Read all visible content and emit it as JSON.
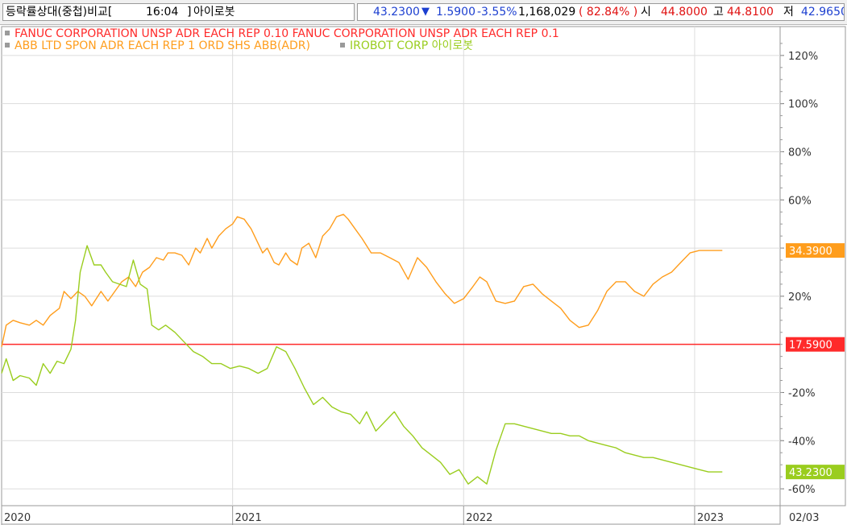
{
  "header": {
    "title": "등락률상대(중첩)비교[",
    "time": "16:04",
    "bracket": "]",
    "stock_name": "아이로봇",
    "price": "43.2300",
    "arrow": "▼",
    "change": "1.5900",
    "change_pct": "-3.55%",
    "volume": "1,168,029",
    "ratio": "( 82.84% )",
    "open_label": "시",
    "open": "44.8000",
    "high_label": "고",
    "high": "44.8100",
    "low_label": "저",
    "low": "42.9650"
  },
  "colors": {
    "fanuc": "#ff2a2a",
    "abb": "#ff9d1c",
    "irobot": "#9acd1e",
    "text_blue": "#1c3fd0",
    "text_red": "#e01010",
    "grid": "#dcdcdc"
  },
  "chart_data": {
    "type": "line",
    "x_ticks": [
      "2020",
      "2021",
      "2022",
      "2023",
      "02/03"
    ],
    "y_ticks": [
      "120%",
      "100%",
      "80%",
      "60%",
      "40%",
      "20%",
      "-20%",
      "-40%",
      "-60%"
    ],
    "legend": [
      "FANUC CORPORATION UNSP ADR EACH REP 0.10  FANUC CORPORATION UNSP ADR EACH REP 0.1",
      "ABB LTD SPON ADR EACH REP 1 ORD SHS  ABB(ADR)",
      "IROBOT CORP  아이로봇"
    ],
    "end_labels": {
      "fanuc": "17.5900",
      "abb": "34.3900",
      "irobot": "43.2300"
    },
    "series": [
      {
        "name": "FANUC CORPORATION UNSP ADR EACH REP 0.10",
        "key": "fanuc",
        "x": [
          0,
          3.12
        ],
        "y": [
          0,
          0
        ]
      },
      {
        "name": "ABB LTD SPON ADR EACH REP 1 ORD SHS",
        "key": "abb",
        "x": [
          0,
          0.02,
          0.05,
          0.08,
          0.12,
          0.15,
          0.18,
          0.21,
          0.25,
          0.27,
          0.3,
          0.33,
          0.36,
          0.39,
          0.43,
          0.46,
          0.49,
          0.52,
          0.55,
          0.58,
          0.61,
          0.64,
          0.67,
          0.7,
          0.72,
          0.75,
          0.78,
          0.81,
          0.84,
          0.86,
          0.89,
          0.91,
          0.94,
          0.97,
          1.0,
          1.02,
          1.05,
          1.08,
          1.1,
          1.13,
          1.15,
          1.18,
          1.2,
          1.23,
          1.25,
          1.28,
          1.3,
          1.33,
          1.36,
          1.39,
          1.42,
          1.45,
          1.48,
          1.5,
          1.53,
          1.56,
          1.6,
          1.64,
          1.68,
          1.72,
          1.76,
          1.8,
          1.84,
          1.88,
          1.92,
          1.96,
          2.0,
          2.04,
          2.07,
          2.1,
          2.14,
          2.18,
          2.22,
          2.26,
          2.3,
          2.34,
          2.38,
          2.42,
          2.46,
          2.5,
          2.54,
          2.58,
          2.62,
          2.66,
          2.7,
          2.74,
          2.78,
          2.82,
          2.86,
          2.9,
          2.94,
          2.98,
          3.02,
          3.06,
          3.1,
          3.12
        ],
        "y": [
          -1,
          8,
          10,
          9,
          8,
          10,
          8,
          12,
          15,
          22,
          19,
          22,
          20,
          16,
          22,
          18,
          22,
          26,
          28,
          24,
          30,
          32,
          36,
          35,
          38,
          38,
          37,
          33,
          40,
          38,
          44,
          40,
          45,
          48,
          50,
          53,
          52,
          48,
          44,
          38,
          40,
          34,
          33,
          38,
          35,
          33,
          40,
          42,
          36,
          45,
          48,
          53,
          54,
          52,
          48,
          44,
          38,
          38,
          36,
          34,
          27,
          36,
          32,
          26,
          21,
          17,
          19,
          24,
          28,
          26,
          18,
          17,
          18,
          24,
          25,
          21,
          18,
          15,
          10,
          7,
          8,
          14,
          22,
          26,
          26,
          22,
          20,
          25,
          28,
          30,
          34,
          38,
          39,
          39,
          39,
          39
        ],
        "xy_note": ""
      },
      {
        "name": "IROBOT CORP",
        "key": "irobot",
        "x": [
          0,
          0.02,
          0.05,
          0.08,
          0.12,
          0.15,
          0.18,
          0.21,
          0.24,
          0.27,
          0.3,
          0.32,
          0.34,
          0.37,
          0.4,
          0.43,
          0.45,
          0.48,
          0.51,
          0.54,
          0.57,
          0.6,
          0.63,
          0.65,
          0.68,
          0.71,
          0.75,
          0.79,
          0.83,
          0.87,
          0.91,
          0.95,
          0.99,
          1.03,
          1.07,
          1.11,
          1.15,
          1.19,
          1.23,
          1.27,
          1.31,
          1.35,
          1.39,
          1.43,
          1.47,
          1.51,
          1.55,
          1.58,
          1.62,
          1.66,
          1.7,
          1.74,
          1.78,
          1.82,
          1.86,
          1.9,
          1.94,
          1.98,
          2.02,
          2.06,
          2.1,
          2.14,
          2.18,
          2.22,
          2.26,
          2.3,
          2.34,
          2.38,
          2.42,
          2.46,
          2.5,
          2.54,
          2.58,
          2.62,
          2.66,
          2.7,
          2.74,
          2.78,
          2.82,
          2.86,
          2.9,
          2.94,
          2.98,
          3.02,
          3.06,
          3.1,
          3.12
        ],
        "y": [
          -12,
          -6,
          -15,
          -13,
          -14,
          -17,
          -8,
          -12,
          -7,
          -8,
          -2,
          10,
          30,
          41,
          33,
          33,
          30,
          26,
          25,
          24,
          35,
          25,
          23,
          8,
          6,
          8,
          5,
          1,
          -3,
          -5,
          -8,
          -8,
          -10,
          -9,
          -10,
          -12,
          -10,
          -1,
          -3,
          -10,
          -18,
          -25,
          -22,
          -26,
          -28,
          -29,
          -33,
          -28,
          -36,
          -32,
          -28,
          -34,
          -38,
          -43,
          -46,
          -49,
          -54,
          -52,
          -58,
          -55,
          -58,
          -44,
          -33,
          -33,
          -34,
          -35,
          -36,
          -37,
          -37,
          -38,
          -38,
          -40,
          -41,
          -42,
          -43,
          -45,
          -46,
          -47,
          -47,
          -48,
          -49,
          -50,
          -51,
          -52,
          -53,
          -53,
          -53
        ]
      }
    ],
    "ylim": [
      -67,
      132
    ],
    "xlim": [
      0,
      3.37
    ]
  }
}
